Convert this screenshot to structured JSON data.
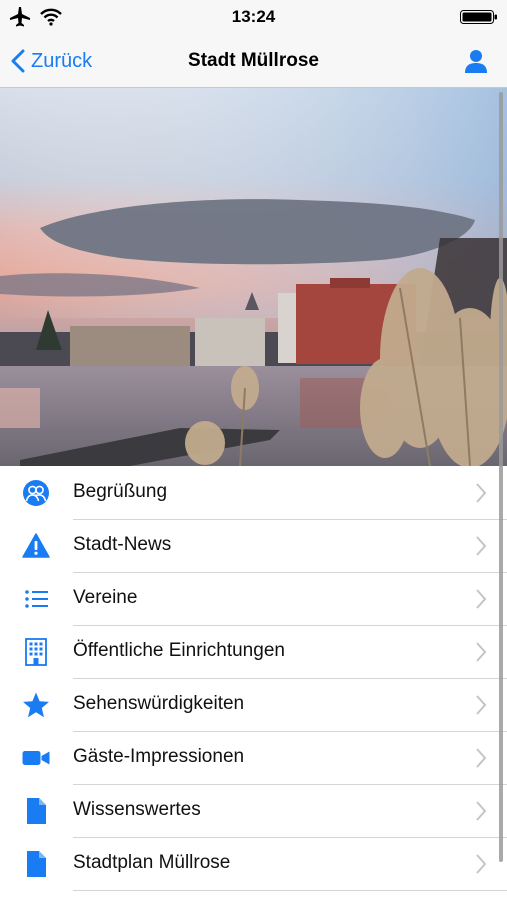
{
  "status_bar": {
    "time": "13:24"
  },
  "navbar": {
    "back_label": "Zurück",
    "title": "Stadt Müllrose"
  },
  "menu": {
    "items": [
      {
        "label": "Begrüßung",
        "icon": "people-circle-icon"
      },
      {
        "label": "Stadt-News",
        "icon": "warning-icon"
      },
      {
        "label": "Vereine",
        "icon": "list-icon"
      },
      {
        "label": "Öffentliche Einrichtungen",
        "icon": "building-icon"
      },
      {
        "label": "Sehenswürdigkeiten",
        "icon": "star-icon"
      },
      {
        "label": "Gäste-Impressionen",
        "icon": "video-camera-icon"
      },
      {
        "label": "Wissenswertes",
        "icon": "document-icon"
      },
      {
        "label": "Stadtplan Müllrose",
        "icon": "document-icon"
      }
    ]
  },
  "colors": {
    "accent": "#1a7cf2",
    "navbar_bg": "#f7f7f7"
  }
}
